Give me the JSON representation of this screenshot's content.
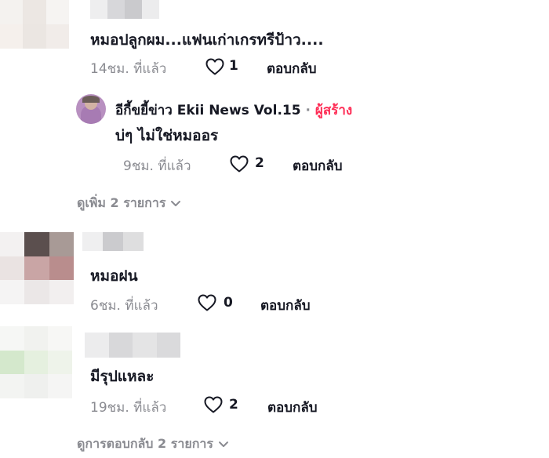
{
  "comments": [
    {
      "text": "หมอปลูกผม...แฟนเก่าเกรทรีป้าว....",
      "time": "14ชม. ที่แล้ว",
      "likes": "1",
      "reply_label": "ตอบกลับ",
      "replies": [
        {
          "username": "อีกี้ขยี้ข่าว Ekii News Vol.15",
          "separator": "·",
          "badge": "ผู้สร้าง",
          "text": "บ่ๆ ไม่ใช่หมออร",
          "time": "9ชม. ที่แล้ว",
          "likes": "2",
          "reply_label": "ตอบกลับ"
        }
      ],
      "view_more": "ดูเพิ่ม 2 รายการ"
    },
    {
      "text": "หมอฝน",
      "time": "6ชม. ที่แล้ว",
      "likes": "0",
      "reply_label": "ตอบกลับ"
    },
    {
      "text": "มีรุปแหละ",
      "time": "19ชม. ที่แล้ว",
      "likes": "2",
      "reply_label": "ตอบกลับ",
      "view_more": "ดูการตอบกลับ 2 รายการ"
    }
  ],
  "colors": {
    "text": "#161823",
    "muted": "#8a8b91",
    "creator_badge": "#fe2c55"
  },
  "icons": [
    "heart-outline-icon",
    "chevron-down-icon"
  ]
}
